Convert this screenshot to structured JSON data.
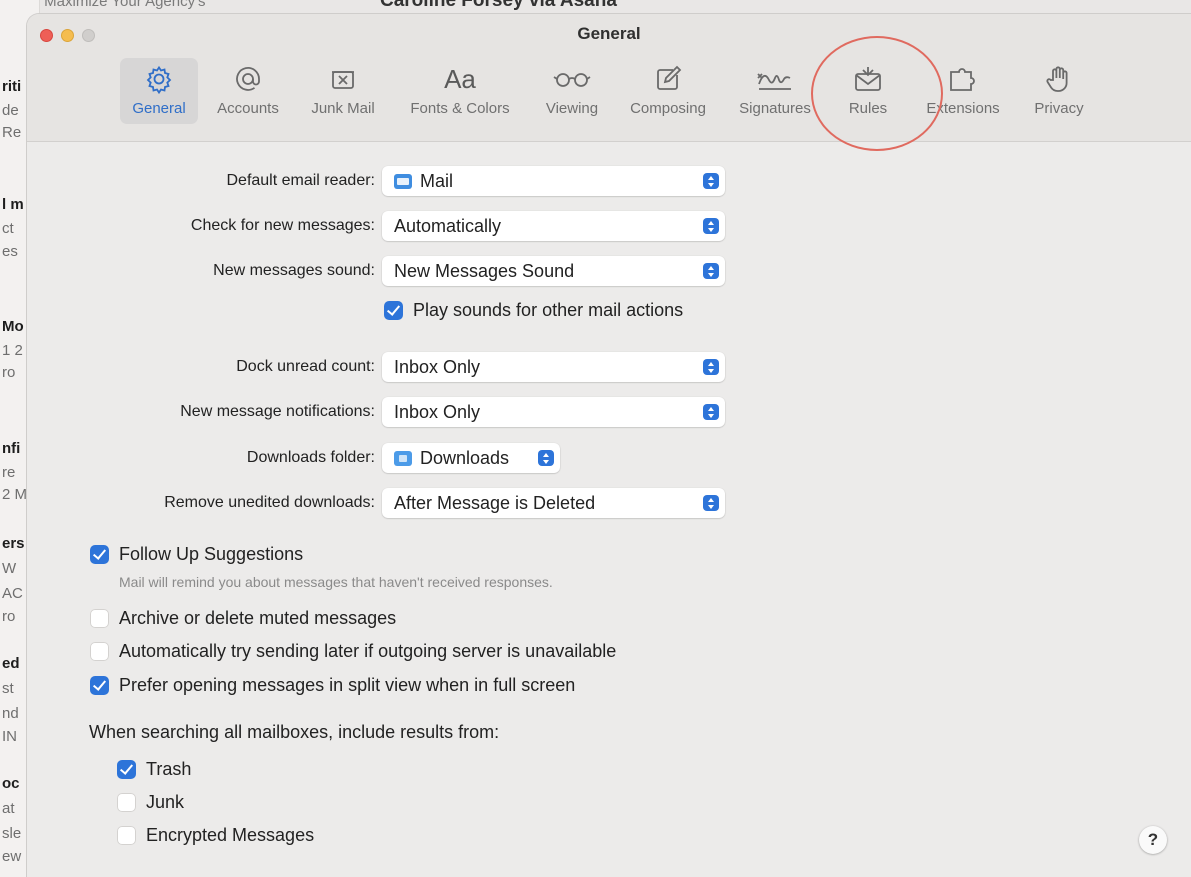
{
  "background": {
    "top_fragment_1": "owser Maximize Your Agency's",
    "top_fragment_2": "Caroline Forsey via Asana",
    "sidebar_fragments": [
      "riti",
      "de",
      "Re",
      "l m",
      "ct",
      "es",
      "Mo",
      "1 2",
      "ro",
      "nfi",
      "re",
      "2 M",
      "ers",
      "W",
      "AC",
      "ro",
      "ed",
      "st",
      "nd",
      "IN",
      "oc",
      "at",
      "sle",
      "ew"
    ]
  },
  "window": {
    "title": "General",
    "traffic_lights": {
      "close": "#ee5f57",
      "minimize": "#f5bd4f",
      "zoom": "#d0cecc"
    }
  },
  "toolbar": {
    "tabs": [
      {
        "id": "general",
        "label": "General",
        "icon": "gear-icon",
        "active": true
      },
      {
        "id": "accounts",
        "label": "Accounts",
        "icon": "at-sign-icon",
        "active": false
      },
      {
        "id": "junk",
        "label": "Junk Mail",
        "icon": "junk-mail-icon",
        "active": false
      },
      {
        "id": "fonts",
        "label": "Fonts & Colors",
        "icon": "font-aa-icon",
        "active": false
      },
      {
        "id": "viewing",
        "label": "Viewing",
        "icon": "glasses-icon",
        "active": false
      },
      {
        "id": "composing",
        "label": "Composing",
        "icon": "compose-pencil-icon",
        "active": false
      },
      {
        "id": "signatures",
        "label": "Signatures",
        "icon": "signature-icon",
        "active": false
      },
      {
        "id": "rules",
        "label": "Rules",
        "icon": "rules-envelope-icon",
        "active": false
      },
      {
        "id": "extensions",
        "label": "Extensions",
        "icon": "puzzle-piece-icon",
        "active": false
      },
      {
        "id": "privacy",
        "label": "Privacy",
        "icon": "hand-icon",
        "active": false
      }
    ],
    "annotation_color": "#e06a5f"
  },
  "form": {
    "default_reader": {
      "label": "Default email reader:",
      "value": "Mail",
      "icon": "mail-app-icon"
    },
    "check_messages": {
      "label": "Check for new messages:",
      "value": "Automatically"
    },
    "messages_sound": {
      "label": "New messages sound:",
      "value": "New Messages Sound"
    },
    "play_sounds": {
      "label": "Play sounds for other mail actions",
      "checked": true
    },
    "dock_unread": {
      "label": "Dock unread count:",
      "value": "Inbox Only"
    },
    "notifications": {
      "label": "New message notifications:",
      "value": "Inbox Only"
    },
    "downloads_folder": {
      "label": "Downloads folder:",
      "value": "Downloads",
      "icon": "downloads-folder-icon"
    },
    "remove_downloads": {
      "label": "Remove unedited downloads:",
      "value": "After Message is Deleted"
    }
  },
  "options": {
    "follow_up": {
      "label": "Follow Up Suggestions",
      "checked": true,
      "hint": "Mail will remind you about messages that haven't received responses."
    },
    "archive_muted": {
      "label": "Archive or delete muted messages",
      "checked": false
    },
    "send_later": {
      "label": "Automatically try sending later if outgoing server is unavailable",
      "checked": false
    },
    "split_view": {
      "label": "Prefer opening messages in split view when in full screen",
      "checked": true
    }
  },
  "search": {
    "heading": "When searching all mailboxes, include results from:",
    "items": [
      {
        "label": "Trash",
        "checked": true
      },
      {
        "label": "Junk",
        "checked": false
      },
      {
        "label": "Encrypted Messages",
        "checked": false
      }
    ]
  },
  "help": {
    "label": "?"
  },
  "colors": {
    "accent": "#2d74d9",
    "window_bg": "#ecebea",
    "toolbar_bg": "#e6e4e2"
  }
}
